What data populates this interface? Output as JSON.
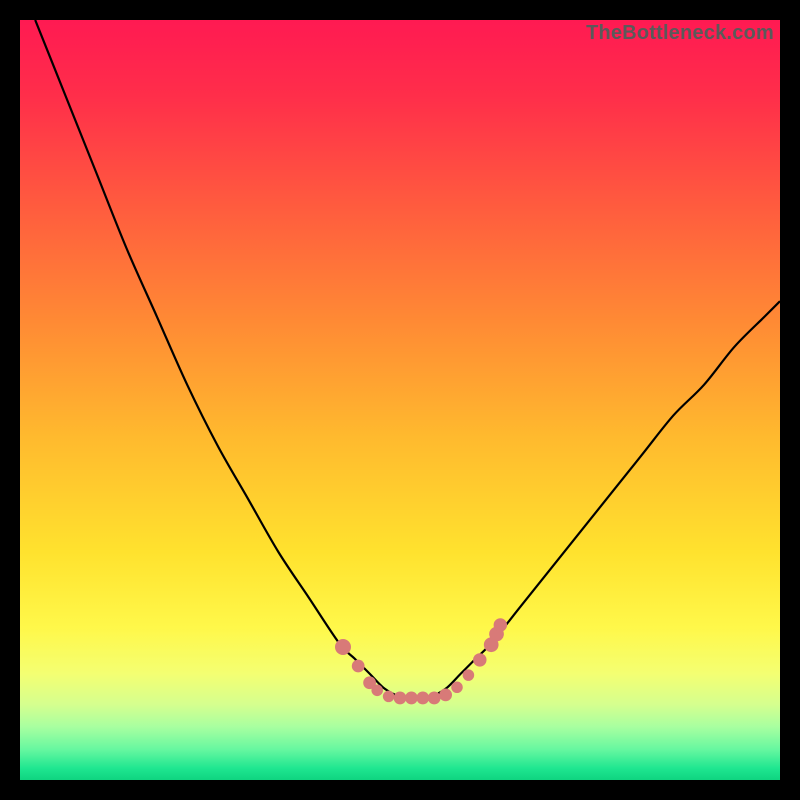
{
  "watermark": "TheBottleneck.com",
  "chart_data": {
    "type": "line",
    "title": "",
    "xlabel": "",
    "ylabel": "",
    "xlim": [
      0,
      100
    ],
    "ylim": [
      0,
      100
    ],
    "grid": false,
    "series": [
      {
        "name": "bottleneck-curve",
        "x": [
          2,
          6,
          10,
          14,
          18,
          22,
          26,
          30,
          34,
          38,
          42,
          44,
          46,
          48,
          50,
          52,
          54,
          56,
          58,
          60,
          62,
          66,
          70,
          74,
          78,
          82,
          86,
          90,
          94,
          98,
          100
        ],
        "y": [
          100,
          90,
          80,
          70,
          61,
          52,
          44,
          37,
          30,
          24,
          18,
          16,
          14,
          12,
          11,
          11,
          11,
          12,
          14,
          16,
          18,
          23,
          28,
          33,
          38,
          43,
          48,
          52,
          57,
          61,
          63
        ]
      }
    ],
    "markers": {
      "name": "highlight-dots",
      "color": "#d87a78",
      "x": [
        42.5,
        44.5,
        46,
        47,
        48.5,
        50,
        51.5,
        53,
        54.5,
        56,
        57.5,
        59,
        60.5,
        62,
        62.7,
        63.2
      ],
      "y": [
        17.5,
        15,
        12.8,
        11.8,
        11,
        10.8,
        10.8,
        10.8,
        10.8,
        11.2,
        12.2,
        13.8,
        15.8,
        17.8,
        19.2,
        20.4
      ],
      "r": [
        5,
        4,
        4,
        3.6,
        3.6,
        4,
        4,
        4,
        4,
        4,
        3.6,
        3.6,
        4.2,
        4.6,
        4.6,
        4.2
      ]
    },
    "background_gradient": {
      "stops": [
        {
          "offset": 0.0,
          "color": "#ff1a52"
        },
        {
          "offset": 0.1,
          "color": "#ff2e4a"
        },
        {
          "offset": 0.25,
          "color": "#ff5d3e"
        },
        {
          "offset": 0.4,
          "color": "#ff8b34"
        },
        {
          "offset": 0.55,
          "color": "#ffba2e"
        },
        {
          "offset": 0.7,
          "color": "#ffe22e"
        },
        {
          "offset": 0.8,
          "color": "#fff84a"
        },
        {
          "offset": 0.86,
          "color": "#f4ff72"
        },
        {
          "offset": 0.9,
          "color": "#d6ff8e"
        },
        {
          "offset": 0.93,
          "color": "#a8ffa0"
        },
        {
          "offset": 0.96,
          "color": "#66f7a0"
        },
        {
          "offset": 0.985,
          "color": "#1ee690"
        },
        {
          "offset": 1.0,
          "color": "#0fd480"
        }
      ]
    }
  }
}
